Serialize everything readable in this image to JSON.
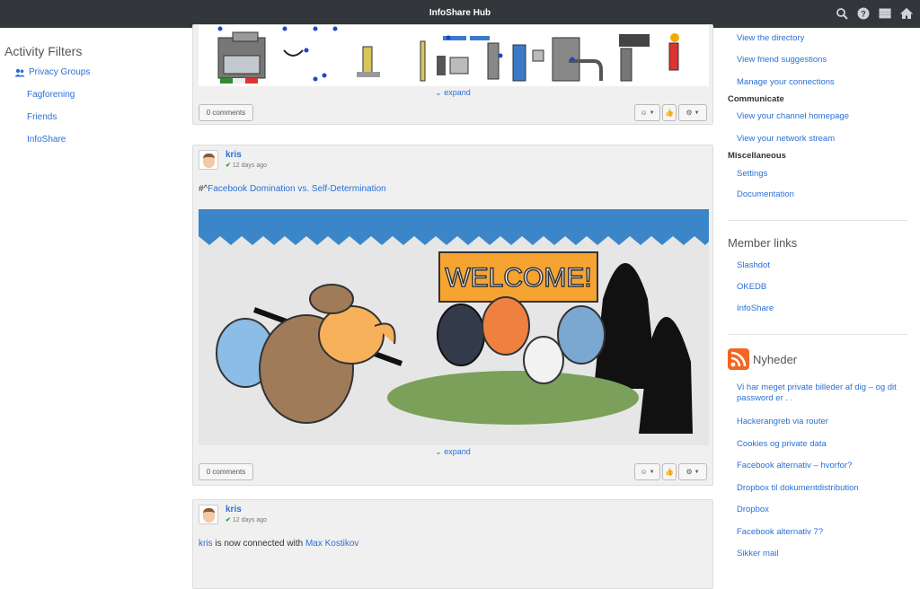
{
  "app": {
    "title": "InfoShare Hub"
  },
  "topbar": {
    "icons": [
      "search-icon",
      "help-icon",
      "apps-grid-icon",
      "home-icon"
    ]
  },
  "left": {
    "title": "Activity Filters",
    "group": "Privacy Groups",
    "items": [
      "Fagforening",
      "Friends",
      "InfoShare"
    ]
  },
  "posts": [
    {
      "expand": "expand",
      "comments": "0 comments"
    },
    {
      "author": "kris",
      "time": "12 days ago",
      "prefix": "#^",
      "link": "Facebook Domination vs. Self-Determination",
      "image_text": "WELCOME!",
      "expand": "expand",
      "comments": "0 comments"
    },
    {
      "author": "kris",
      "time": "12 days ago",
      "actor": "kris",
      "verb": "is now connected with",
      "target": "Max Kostikov"
    }
  ],
  "right": {
    "top_links": [
      "View the directory",
      "View friend suggestions",
      "Manage your connections"
    ],
    "communicate": {
      "title": "Communicate",
      "links": [
        "View your channel homepage",
        "View your network stream"
      ]
    },
    "misc": {
      "title": "Miscellaneous",
      "links": [
        "Settings",
        "Documentation"
      ]
    },
    "member": {
      "title": "Member links",
      "links": [
        "Slashdot",
        "OKEDB",
        "InfoShare"
      ]
    },
    "news": {
      "title": "Nyheder",
      "links": [
        "Vi har meget private billeder af dig – og dit password er . .",
        "Hackerangreb via router",
        "Cookies og private data",
        "Facebook alternativ – hvorfor?",
        "Dropbox til dokumentdistribution",
        "Dropbox",
        "Facebook alternativ 7?",
        "Sikker mail"
      ]
    }
  }
}
